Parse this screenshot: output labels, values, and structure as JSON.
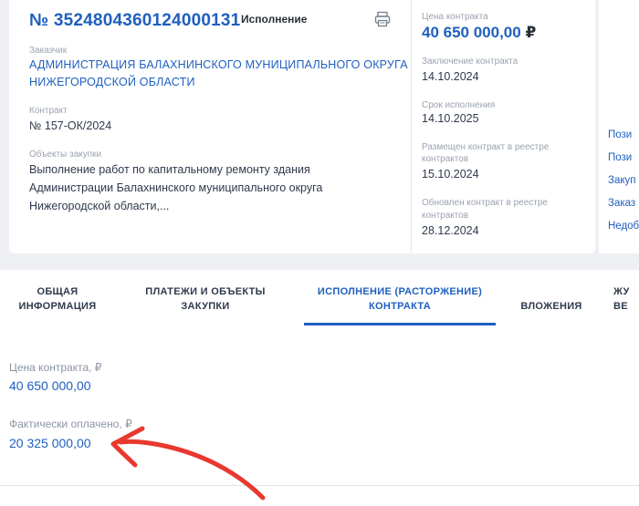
{
  "contract": {
    "number": "№ 3524804360124000131",
    "status": "Исполнение",
    "customer_label": "Заказчик",
    "customer_line1": "АДМИНИСТРАЦИЯ БАЛАХНИНСКОГО МУНИЦИПАЛЬНОГО ОКРУГА",
    "customer_line2": "НИЖЕГОРОДСКОЙ ОБЛАСТИ",
    "contract_label": "Контракт",
    "contract_value": "№ 157-ОК/2024",
    "objects_label": "Объекты закупки",
    "objects_line1": "Выполнение работ по капитальному ремонту здания",
    "objects_line2": "Администрации Балахнинского муниципального округа",
    "objects_line3": "Нижегородской области,..."
  },
  "details": {
    "price_label": "Цена контракта",
    "price_value": "40 650 000,00",
    "price_currency": "₽",
    "conclusion_label": "Заключение контракта",
    "conclusion_value": "14.10.2024",
    "term_label": "Срок исполнения",
    "term_value": "14.10.2025",
    "placed_label_line1": "Размещен контракт в реестре",
    "placed_label_line2": "контрактов",
    "placed_value": "15.10.2024",
    "updated_label_line1": "Обновлен контракт в реестре",
    "updated_label_line2": "контрактов",
    "updated_value": "28.12.2024"
  },
  "side_links": [
    "Пози",
    "Пози",
    "Закуп",
    "Заказ",
    "Недоб"
  ],
  "tabs": [
    {
      "line1": "ОБЩАЯ",
      "line2": "ИНФОРМАЦИЯ"
    },
    {
      "line1": "ПЛАТЕЖИ И ОБЪЕКТЫ",
      "line2": "ЗАКУПКИ"
    },
    {
      "line1": "ИСПОЛНЕНИЕ (РАСТОРЖЕНИЕ)",
      "line2": "КОНТРАКТА"
    },
    {
      "line1": "ВЛОЖЕНИЯ",
      "line2": ""
    },
    {
      "line1": "ЖУ",
      "line2": "ВЕ"
    }
  ],
  "execution": {
    "price_label": "Цена контракта, ₽",
    "price_value": "40 650 000,00",
    "paid_label": "Фактически оплачено, ₽",
    "paid_value": "20 325 000,00"
  },
  "colors": {
    "accent": "#1f5fbf",
    "annotation_arrow": "#e8392f"
  }
}
